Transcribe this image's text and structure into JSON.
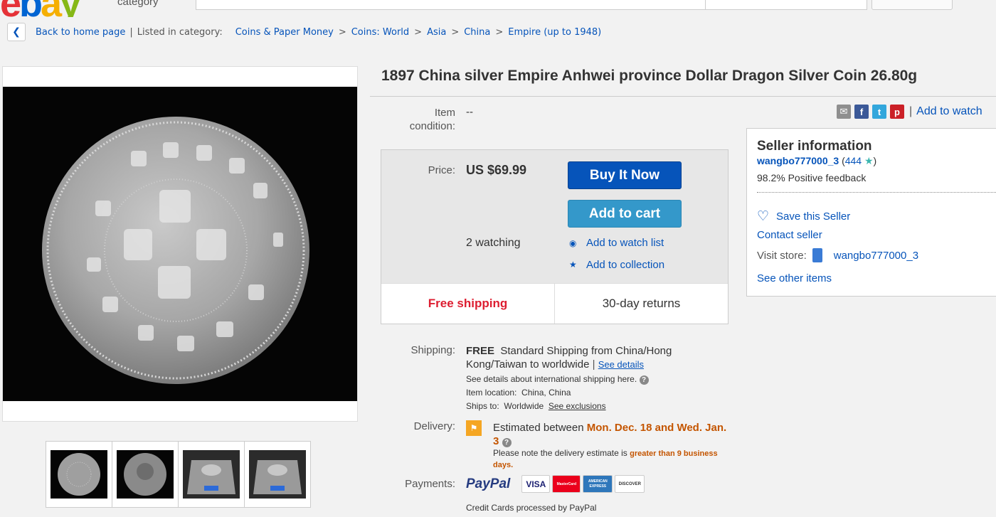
{
  "header": {
    "logo": [
      "e",
      "b",
      "a",
      "y"
    ],
    "category_label": "category"
  },
  "breadcrumb": {
    "back_label": "Back to home page",
    "separator": "|",
    "listed_label": "Listed in category:",
    "items": [
      "Coins & Paper Money",
      "Coins: World",
      "Asia",
      "China",
      "Empire (up to 1948)"
    ],
    "gt": ">"
  },
  "listing": {
    "title": "1897 China silver Empire Anhwei province Dollar Dragon Silver Coin 26.80g",
    "condition_label": "Item condition:",
    "condition_value": "--",
    "add_to_watch": "Add to watch",
    "share_separator": "|",
    "price_label": "Price:",
    "price": "US $69.99",
    "buy_now": "Buy It Now",
    "add_to_cart": "Add to cart",
    "watching": "2 watching",
    "add_to_watch_list": "Add to watch list",
    "add_to_collection": "Add to collection",
    "free_shipping": "Free shipping",
    "returns": "30-day returns"
  },
  "shipping": {
    "label": "Shipping:",
    "free": "FREE",
    "desc": "Standard Shipping from China/Hong Kong/Taiwan to worldwide",
    "pipe": "|",
    "see_details": "See details",
    "intl_note": "See details about international shipping here.",
    "location_label": "Item location:",
    "location": "China, China",
    "ships_to_label": "Ships to:",
    "ships_to": "Worldwide",
    "see_exclusions": "See exclusions"
  },
  "delivery": {
    "label": "Delivery:",
    "estimated": "Estimated between",
    "dates": "Mon. Dec. 18 and Wed. Jan. 3",
    "note_pre": "Please note the delivery estimate is",
    "note_em": "greater than 9 business days."
  },
  "payments": {
    "label": "Payments:",
    "paypal": "PayPal",
    "cards": [
      "VISA",
      "MasterCard",
      "AMERICAN EXPRESS",
      "DISCOVER"
    ],
    "note": "Credit Cards processed by PayPal"
  },
  "seller": {
    "heading": "Seller information",
    "name": "wangbo777000_3",
    "score_open": "(",
    "score": "444",
    "score_close": ")",
    "feedback": "98.2% Positive feedback",
    "save": "Save this Seller",
    "contact": "Contact seller",
    "visit_label": "Visit store:",
    "store_name": "wangbo777000_3",
    "other_items": "See other items"
  },
  "colors": {
    "link": "#0654ba",
    "buy_button": "#0654ba",
    "cart_button": "#3498ca",
    "free_shipping": "#dd1e31",
    "delivery_dates": "#c45500"
  }
}
